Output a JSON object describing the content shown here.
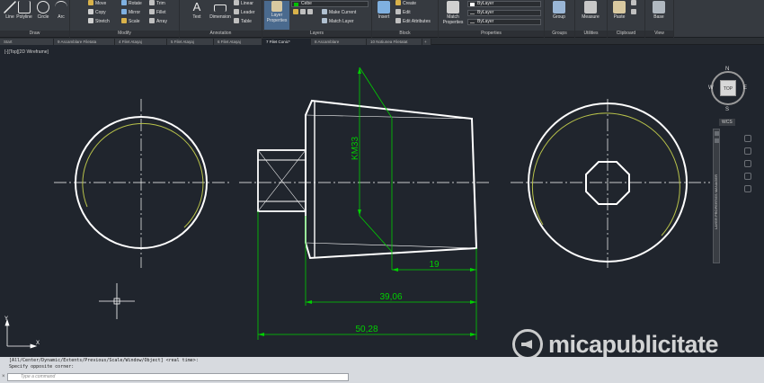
{
  "ribbon": {
    "draw": {
      "title": "Draw",
      "line": "Line",
      "polyline": "Polyline",
      "circle": "Circle",
      "arc": "Arc"
    },
    "modify": {
      "title": "Modify",
      "move": "Move",
      "rotate": "Rotate",
      "trim": "Trim",
      "copy": "Copy",
      "mirror": "Mirror",
      "fillet": "Fillet",
      "stretch": "Stretch",
      "scale": "Scale",
      "array": "Array"
    },
    "annotation": {
      "title": "Annotation",
      "text": "Text",
      "dimension": "Dimension",
      "linear": "Linear",
      "leader": "Leader",
      "table": "Table"
    },
    "layers": {
      "title": "Layers",
      "layer_properties": "Layer Properties",
      "layer_name": "Cebe",
      "make_current": "Make Current",
      "match_layer": "Match Layer"
    },
    "block": {
      "title": "Block",
      "insert": "Insert",
      "create": "Create",
      "edit": "Edit",
      "edit_attributes": "Edit Attributes"
    },
    "properties": {
      "title": "Properties",
      "match_properties": "Match Properties",
      "color": "ByLayer",
      "linetype": "ByLayer",
      "lineweight": "ByLayer"
    },
    "groups": {
      "title": "Groups",
      "group": "Group"
    },
    "utilities": {
      "title": "Utilities",
      "measure": "Measure"
    },
    "clipboard": {
      "title": "Clipboard",
      "paste": "Paste"
    },
    "view": {
      "title": "View",
      "base": "Base"
    }
  },
  "file_tabs": [
    "Start",
    "9 Ascamblare Filetata",
    "4 Filet Ataşaj",
    "5 Filet Ataşaj",
    "6 Filet Ataşaj",
    "7 Filet Conic*",
    "8 Ascamblare",
    "10 Notiunea Filetatat"
  ],
  "viewport_label": "[-][Top][2D Wireframe]",
  "viewcube": {
    "n": "N",
    "s": "S",
    "e": "E",
    "w": "W",
    "face": "TOP",
    "wcs": "WCS"
  },
  "navbar_text": "LAYER PROPERTIES MANAGER",
  "drawing": {
    "thread_label": "KM33",
    "dim_small": "19",
    "dim_mid": "39,06",
    "dim_large": "50,28"
  },
  "command": {
    "history_line1": "[All/Center/Dynamic/Extents/Previous/Scale/Window/Object] <real time>:",
    "history_line2": "Specify opposite corner:",
    "placeholder": "Type a command"
  },
  "watermark": "micapublicitate",
  "colors": {
    "drawing_lines": "#ffffff",
    "dimensions": "#00d000",
    "thread": "#b8c24a",
    "axes": "#ffffff",
    "layer_swatch": "#00c000"
  }
}
